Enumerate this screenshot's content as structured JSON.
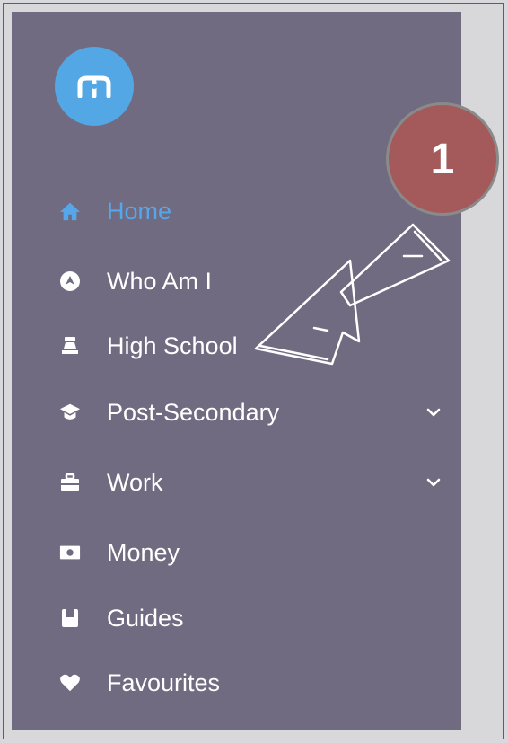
{
  "nav": {
    "items": [
      {
        "label": "Home",
        "icon": "home-icon",
        "active": true
      },
      {
        "label": "Who Am I",
        "icon": "compass-icon"
      },
      {
        "label": "High School",
        "icon": "school-icon"
      },
      {
        "label": "Post-Secondary",
        "icon": "graduation-cap-icon",
        "has_submenu": true
      },
      {
        "label": "Work",
        "icon": "briefcase-icon",
        "has_submenu": true
      },
      {
        "label": "Money",
        "icon": "money-icon"
      },
      {
        "label": "Guides",
        "icon": "book-icon"
      },
      {
        "label": "Favourites",
        "icon": "heart-icon"
      }
    ]
  },
  "callout": {
    "number": "1"
  },
  "colors": {
    "sidebar_bg": "#706b80",
    "active": "#58a6ea",
    "logo_bg": "#54a7e5",
    "badge_bg": "#a45a5b",
    "page_bg": "#d9d8dc"
  }
}
